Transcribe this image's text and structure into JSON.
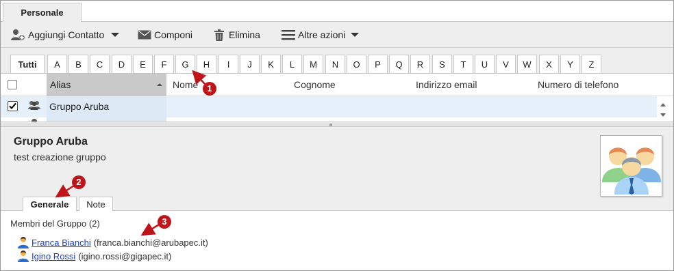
{
  "top_tab": {
    "label": "Personale"
  },
  "toolbar": {
    "add_contact": "Aggiungi Contatto",
    "compose": "Componi",
    "delete": "Elimina",
    "more_actions": "Altre azioni"
  },
  "alphabet": {
    "all": "Tutti",
    "letters": [
      "A",
      "B",
      "C",
      "D",
      "E",
      "F",
      "G",
      "H",
      "I",
      "J",
      "K",
      "L",
      "M",
      "N",
      "O",
      "P",
      "Q",
      "R",
      "S",
      "T",
      "U",
      "V",
      "W",
      "X",
      "Y",
      "Z"
    ]
  },
  "table": {
    "columns": {
      "alias": "Alias",
      "nome": "Nome",
      "cognome": "Cognome",
      "email": "Indirizzo email",
      "phone": "Numero di telefono"
    },
    "rows": [
      {
        "alias": "Gruppo Aruba",
        "checked": true
      }
    ]
  },
  "detail": {
    "title": "Gruppo Aruba",
    "subtitle": "test creazione gruppo",
    "tabs": [
      "Generale",
      "Note"
    ]
  },
  "members": {
    "title": "Membri del Gruppo (2)",
    "list": [
      {
        "name": "Franca Bianchi",
        "email": "(franca.bianchi@arubapec.it)"
      },
      {
        "name": "Igino Rossi",
        "email": "(igino.rossi@gigapec.it)"
      }
    ]
  },
  "annotations": [
    "1",
    "2",
    "3"
  ],
  "colors": {
    "badge": "#c0141b",
    "link": "#1a3fcf",
    "row_selected": "#e6f0fa"
  }
}
